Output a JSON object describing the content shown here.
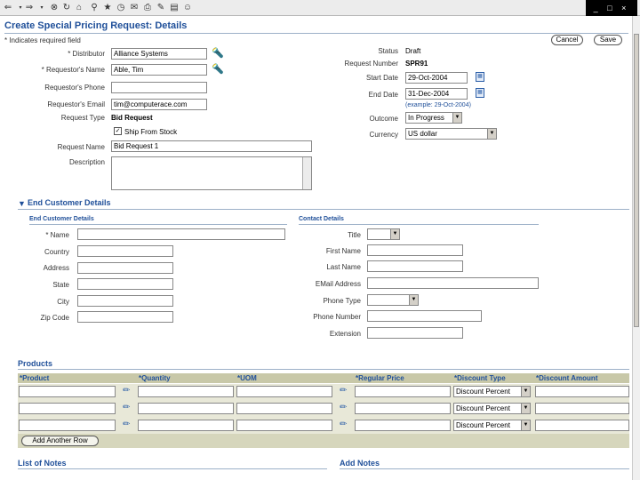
{
  "window_controls": "_ □ ×",
  "toolbar_icons": [
    "back-icon",
    "forward-icon",
    "stop-icon",
    "refresh-icon",
    "home-icon",
    "search-icon",
    "favorites-icon",
    "history-icon",
    "mail-icon",
    "print-icon",
    "edit-icon"
  ],
  "title": "Create Special Pricing Request: Details",
  "required_note": "* Indicates required field",
  "buttons": {
    "cancel": "Cancel",
    "save": "Save"
  },
  "left_fields": {
    "distributor": {
      "label": "* Distributor",
      "value": "Alliance Systems"
    },
    "requestor_name": {
      "label": "* Requestor's Name",
      "value": "Able, Tim"
    },
    "requestor_phone": {
      "label": "Requestor's Phone",
      "value": ""
    },
    "requestor_email": {
      "label": "Requestor's Email",
      "value": "tim@computerace.com"
    },
    "request_type": {
      "label": "Request Type",
      "value": "Bid Request"
    },
    "ship_from_stock": {
      "label": "Ship From Stock",
      "checked": true
    },
    "request_name": {
      "label": "Request Name",
      "value": "Bid Request 1"
    },
    "description": {
      "label": "Description",
      "value": ""
    }
  },
  "right_fields": {
    "status": {
      "label": "Status",
      "value": "Draft"
    },
    "request_number": {
      "label": "Request Number",
      "value": "SPR91"
    },
    "start_date": {
      "label": "Start Date",
      "value": "29-Oct-2004"
    },
    "end_date": {
      "label": "End Date",
      "value": "31-Dec-2004"
    },
    "date_example": "(example: 29-Oct-2004)",
    "outcome": {
      "label": "Outcome",
      "value": "In Progress"
    },
    "currency": {
      "label": "Currency",
      "value": "US dollar"
    }
  },
  "end_customer": {
    "section_title": "End Customer Details",
    "subsection_customer": "End Customer Details",
    "subsection_contact": "Contact Details",
    "customer_fields": [
      "* Name",
      "Country",
      "Address",
      "State",
      "City",
      "Zip Code"
    ],
    "contact_fields": [
      "Title",
      "First Name",
      "Last Name",
      "EMail Address",
      "Phone Type",
      "Phone Number",
      "Extension"
    ]
  },
  "products": {
    "section_title": "Products",
    "columns": [
      "*Product",
      "*Quantity",
      "*UOM",
      "*Regular Price",
      "*Discount Type",
      "*Discount Amount"
    ],
    "discount_default": "Discount Percent",
    "row_count": 3,
    "add_row_button": "Add Another Row"
  },
  "notes": {
    "list_title": "List of Notes",
    "add_title": "Add Notes"
  }
}
